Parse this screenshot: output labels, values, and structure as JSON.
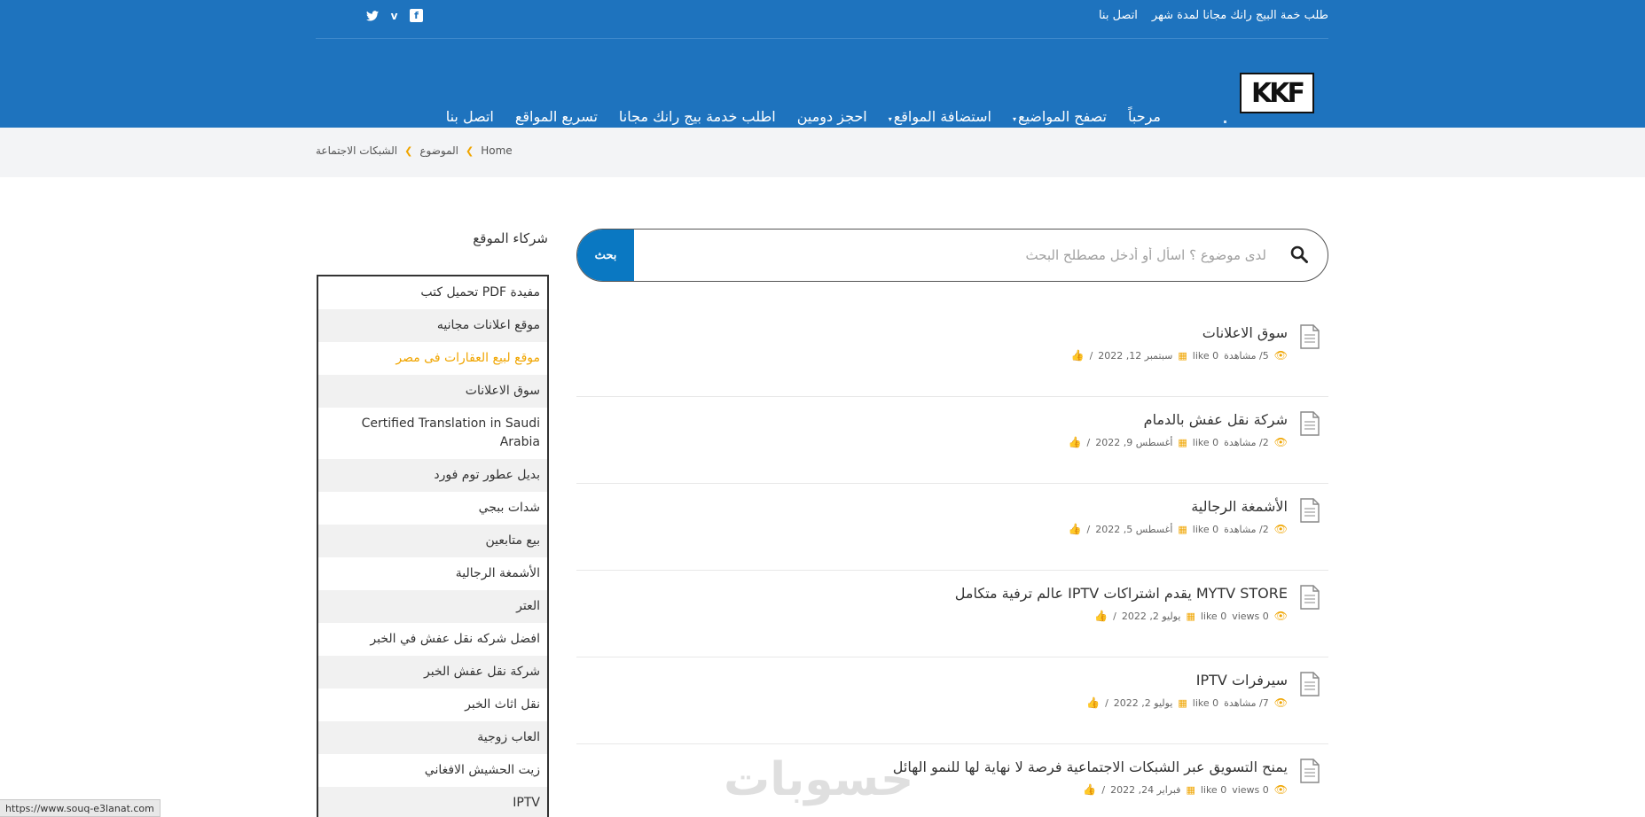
{
  "topbar": {
    "links": [
      "طلب خمة البيج رانك مجانا لمدة شهر",
      "اتصل بنا"
    ],
    "social": [
      "twitter-icon",
      "vimeo-icon",
      "facebook-icon"
    ]
  },
  "header": {
    "logo_text": "KKF",
    "nav": [
      {
        "label": "مرحباً",
        "caret": ""
      },
      {
        "label": "تصفح المواضيع",
        "caret": "▾"
      },
      {
        "label": "استضافة المواقع",
        "caret": "▾"
      },
      {
        "label": "احجز دومين",
        "caret": ""
      },
      {
        "label": "اطلب خدمة بيج رانك مجانا",
        "caret": ""
      },
      {
        "label": "تسريع المواقع",
        "caret": ""
      },
      {
        "label": "اتصل بنا",
        "caret": ""
      }
    ]
  },
  "breadcrumb": [
    "Home",
    "الموضوع",
    "الشبكات الاجتماعة"
  ],
  "search": {
    "placeholder": "لدى موضوع ؟ اسأل أو أدخل مصطلح البحث",
    "button": "بحث"
  },
  "posts": [
    {
      "title": "سوق الاعلانات",
      "views": "5/ مشاهدة",
      "likes": "0 like",
      "date": "سبتمبر 12, 2022"
    },
    {
      "title": "شركة نقل عفش بالدمام",
      "views": "2/ مشاهدة",
      "likes": "0 like",
      "date": "أغسطس 9, 2022"
    },
    {
      "title": "الأشمغة الرجالية",
      "views": "2/ مشاهدة",
      "likes": "0 like",
      "date": "أغسطس 5, 2022"
    },
    {
      "title": "MYTV STORE يقدم اشتراكات IPTV عالم ترفية متكامل",
      "views": "0 views",
      "likes": "0 like",
      "date": "يوليو 2, 2022"
    },
    {
      "title": "سيرفرات IPTV",
      "views": "7/ مشاهدة",
      "likes": "0 like",
      "date": "يوليو 2, 2022"
    },
    {
      "title": "يمنح التسويق عبر الشبكات الاجتماعية فرصة لا نهاية لها للنمو الهائل",
      "views": "0 views",
      "likes": "0 like",
      "date": "فبراير 24, 2022"
    }
  ],
  "sidebar": {
    "title": "شركاء الموقع",
    "items": [
      "مفيدة PDF تحميل كتب",
      "موقع اعلانات مجانيه",
      "موقع لبيع العقارات فى مصر",
      "سوق الاعلانات",
      "Certified Translation in Saudi Arabia",
      "بديل عطور توم فورد",
      "شدات ببجي",
      "بيع متابعين",
      "الأشمغة الرجالية",
      "العتر",
      "افضل شركه نقل عفش في الخبر",
      "شركة نقل عفش الخبر",
      "نقل اثاث الخبر",
      "العاب زوجية",
      "زيت الحشيش الافغاني",
      "IPTV"
    ],
    "active_index": 2
  },
  "watermark": "حسوبات",
  "status_url": "https://www.souq-e3lanat.com",
  "colors": {
    "brand": "#1e73be",
    "accent": "#f0a500",
    "search_button": "#0a78c2"
  }
}
